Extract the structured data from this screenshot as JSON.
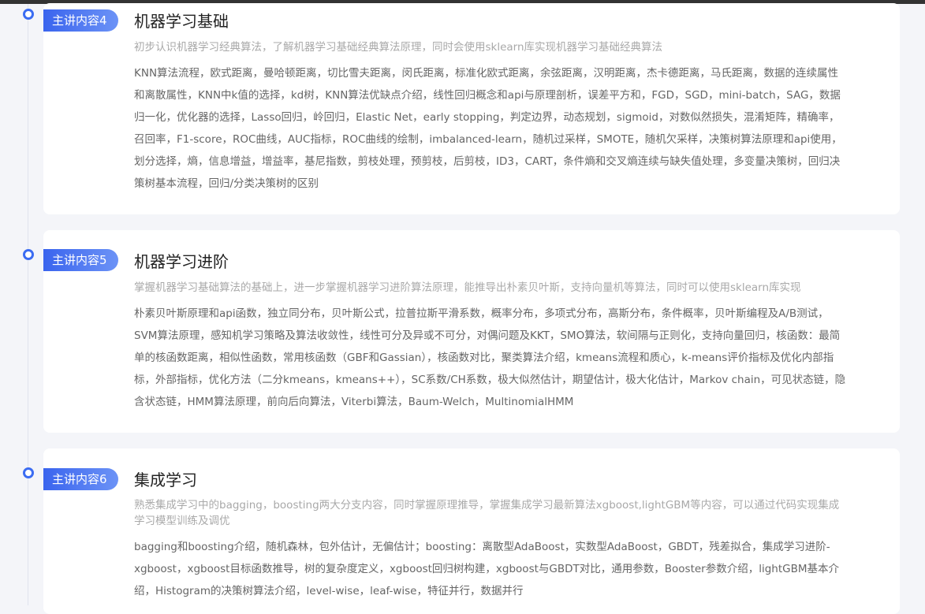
{
  "sections": [
    {
      "badge": "主讲内容4",
      "title": "机器学习基础",
      "subtitle": "初步认识机器学习经典算法，了解机器学习基础经典算法原理，同时会使用sklearn库实现机器学习基础经典算法",
      "body": "KNN算法流程，欧式距离，曼哈顿距离，切比雪夫距离，闵氏距离，标准化欧式距离，余弦距离，汉明距离，杰卡德距离，马氏距离，数据的连续属性和离散属性，KNN中k值的选择，kd树，KNN算法优缺点介绍，线性回归概念和api与原理剖析，误差平方和，FGD，SGD，mini-batch，SAG，数据归一化，优化器的选择，Lasso回归，岭回归，Elastic Net，early stopping，判定边界，动态规划，sigmoid，对数似然损失，混淆矩阵，精确率，召回率，F1-score，ROC曲线，AUC指标，ROC曲线的绘制，imbalanced-learn，随机过采样，SMOTE，随机欠采样，决策树算法原理和api使用，划分选择，熵，信息增益，增益率，基尼指数，剪枝处理，预剪枝，后剪枝，ID3，CART，条件熵和交叉熵连续与缺失值处理，多变量决策树，回归决策树基本流程，回归/分类决策树的区别"
    },
    {
      "badge": "主讲内容5",
      "title": "机器学习进阶",
      "subtitle": "掌握机器学习基础算法的基础上，进一步掌握机器学习进阶算法原理，能推导出朴素贝叶斯，支持向量机等算法，同时可以使用sklearn库实现",
      "body": "朴素贝叶斯原理和api函数，独立同分布，贝叶斯公式，拉普拉斯平滑系数，概率分布，多项式分布，高斯分布，条件概率，贝叶斯编程及A/B测试，SVM算法原理，感知机学习策略及算法收敛性，线性可分及异或不可分，对偶问题及KKT，SMO算法，软间隔与正则化，支持向量回归，核函数：最简单的核函数距离，相似性函数，常用核函数（GBF和Gassian），核函数对比，聚类算法介绍，kmeans流程和质心，k-means评价指标及优化内部指标，外部指标，优化方法（二分kmeans，kmeans++），SC系数/CH系数，极大似然估计，期望估计，极大化估计，Markov chain，可见状态链，隐含状态链，HMM算法原理，前向后向算法，Viterbi算法，Baum-Welch，MultinomialHMM"
    },
    {
      "badge": "主讲内容6",
      "title": "集成学习",
      "subtitle": "熟悉集成学习中的bagging，boosting两大分支内容，同时掌握原理推导，掌握集成学习最新算法xgboost,lightGBM等内容，可以通过代码实现集成学习模型训练及调优",
      "body": "bagging和boosting介绍，随机森林，包外估计，无偏估计；boosting：离散型AdaBoost，实数型AdaBoost，GBDT，残差拟合，集成学习进阶-xgboost，xgboost目标函数推导，树的复杂度定义，xgboost回归树构建，xgboost与GBDT对比，通用参数，Booster参数介绍，lightGBM基本介绍，Histogram的决策树算法介绍，level-wise，leaf-wise，特征并行，数据并行"
    }
  ]
}
